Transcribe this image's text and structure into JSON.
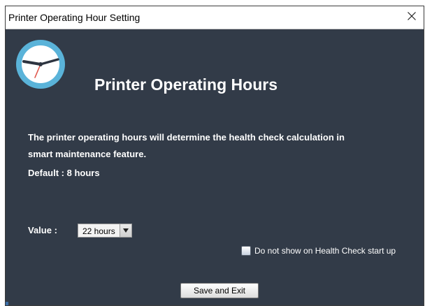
{
  "window": {
    "title": "Printer Operating Hour Setting",
    "close_icon": "close-icon",
    "close_glyph": "✕"
  },
  "header": {
    "icon": "clock-icon",
    "heading": "Printer Operating Hours"
  },
  "body": {
    "description": "The printer operating hours will determine the health check calculation in smart maintenance feature.",
    "default_text": "Default : 8 hours"
  },
  "form": {
    "value_label": "Value :",
    "selected_value": "22 hours",
    "arrow_icon": "dropdown-arrow-icon",
    "dont_show_label": "Do not show on Health Check start up",
    "dont_show_checked": false
  },
  "actions": {
    "save_label": "Save and Exit"
  },
  "colors": {
    "content_bg": "#323b48",
    "clock_face": "#5ab3d9",
    "text": "#ffffff"
  }
}
